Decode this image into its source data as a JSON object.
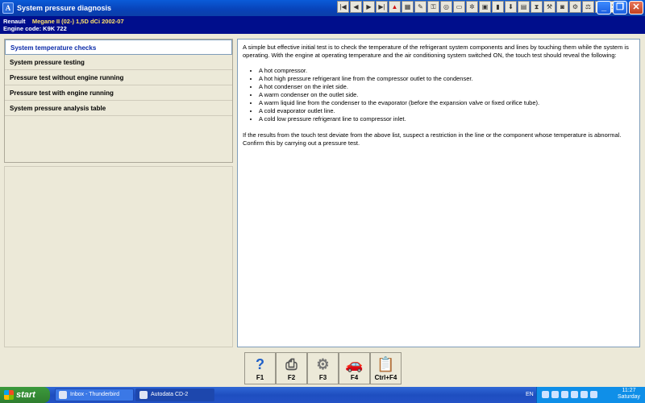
{
  "window": {
    "title": "System pressure diagnosis",
    "app_icon_glyph": "A"
  },
  "vehicle": {
    "make": "Renault",
    "model": "Megane II (02-) 1,5D dCi 2002-07",
    "engine_code": "Engine code: K9K 722"
  },
  "toolbar_icons": [
    "first-icon",
    "prev-icon",
    "next-icon",
    "last-icon",
    "warning-icon",
    "calculator-icon",
    "tools-icon",
    "key-icon",
    "wheel-icon",
    "car-icon",
    "fan-icon",
    "engine-icon",
    "battery-icon",
    "injector-icon",
    "book-icon",
    "filter-icon",
    "wrench-icon",
    "camera-icon",
    "settings-icon",
    "scales-icon",
    "light-icon",
    "exit-icon"
  ],
  "nav": {
    "items": [
      {
        "label": "System temperature checks",
        "active": true
      },
      {
        "label": "System pressure testing",
        "active": false
      },
      {
        "label": "Pressure test without engine running",
        "active": false
      },
      {
        "label": "Pressure test with engine running",
        "active": false
      },
      {
        "label": "System pressure analysis table",
        "active": false
      }
    ]
  },
  "content": {
    "intro": "A simple but effective initial test is to check the temperature of the refrigerant system components and lines by touching them while the system is operating. With the engine at operating temperature and the air conditioning system switched ON, the touch test should reveal the following:",
    "bullets": [
      "A hot compressor.",
      "A hot high pressure refrigerant line from the compressor outlet to the condenser.",
      "A hot condenser on the inlet side.",
      "A warm condenser on the outlet side.",
      "A warm liquid line from the condenser to the evaporator (before the expansion valve or fixed orifice tube).",
      "A cold evaporator outlet line.",
      "A cold low pressure refrigerant line to compressor inlet."
    ],
    "conclusion": "If the results from the touch test deviate from the above list, suspect a restriction in the line or the component whose temperature is abnormal. Confirm this by carrying out a pressure test."
  },
  "fkeys": [
    {
      "label": "F1",
      "icon": "help-icon"
    },
    {
      "label": "F2",
      "icon": "print-icon"
    },
    {
      "label": "F3",
      "icon": "gear-icon"
    },
    {
      "label": "F4",
      "icon": "car-icon"
    },
    {
      "label": "Ctrl+F4",
      "icon": "document-icon"
    }
  ],
  "taskbar": {
    "start_label": "start",
    "tasks": [
      {
        "label": "Inbox - Thunderbird"
      },
      {
        "label": "Autodata CD-2"
      }
    ],
    "lang": "EN",
    "time": "11:27",
    "day": "Saturday"
  }
}
